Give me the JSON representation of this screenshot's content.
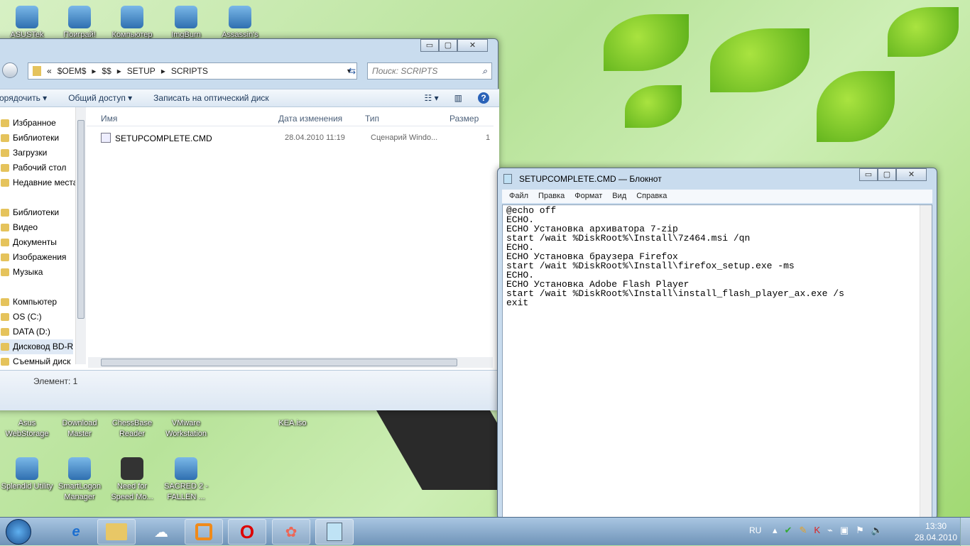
{
  "desktop": {
    "icons_top": [
      "ASUSTek",
      "Поиграй!",
      "Компьютер",
      "ImgBurn",
      "Assassin's"
    ],
    "icons_mid": [
      "Asus WebStorage",
      "Download Master",
      "ChessBase Reader",
      "VMware Workstation",
      "KEA.iso"
    ],
    "icons_bottom": [
      "Splendid Utility",
      "SmartLogon Manager",
      "Need for Speed Mo...",
      "SACRED 2 - FALLEN ..."
    ]
  },
  "explorer": {
    "breadcrumb": [
      "«",
      "$OEM$",
      "$$",
      "SETUP",
      "SCRIPTS"
    ],
    "search_placeholder": "Поиск: SCRIPTS",
    "toolbar": {
      "organize": "орядочить",
      "share": "Общий доступ",
      "burn": "Записать на оптический диск"
    },
    "nav": [
      "Избранное",
      "Библиотеки",
      "Загрузки",
      "Рабочий стол",
      "Недавние места",
      "Библиотеки",
      "Видео",
      "Документы",
      "Изображения",
      "Музыка",
      "Компьютер",
      "OS (C:)",
      "DATA (D:)",
      "Дисковод BD-R",
      "Съемный диск"
    ],
    "columns": [
      "Имя",
      "Дата изменения",
      "Тип",
      "Размер"
    ],
    "files": [
      {
        "name": "SETUPCOMPLETE.CMD",
        "date": "28.04.2010 11:19",
        "type": "Сценарий Windo...",
        "size": "1"
      }
    ],
    "status": "Элемент: 1"
  },
  "notepad": {
    "title": "SETUPCOMPLETE.CMD — Блокнот",
    "menu": [
      "Файл",
      "Правка",
      "Формат",
      "Вид",
      "Справка"
    ],
    "content": "@echo off\nECHO.\nECHO Установка архиватора 7-zip\nstart /wait %DiskRoot%\\Install\\7z464.msi /qn\nECHO.\nECHO Установка браузера Firefox\nstart /wait %DiskRoot%\\Install\\firefox_setup.exe -ms\nECHO.\nECHO Установка Adobe Flash Player\nstart /wait %DiskRoot%\\Install\\install_flash_player_ax.exe /s\nexit"
  },
  "taskbar": {
    "lang": "RU",
    "time": "13:30",
    "date": "28.04.2010"
  }
}
